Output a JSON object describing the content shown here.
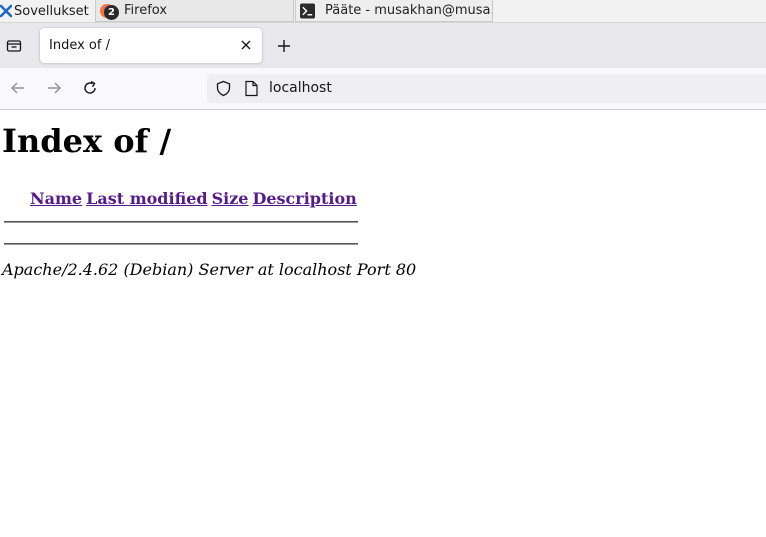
{
  "taskbar": {
    "apps_label": "Sovellukset",
    "tasks": [
      {
        "label": "Firefox",
        "badge": "2",
        "icon": "firefox-icon"
      },
      {
        "label": "Pääte - musakhan@musa...",
        "icon": "terminal-icon"
      }
    ]
  },
  "browser": {
    "tab": {
      "title": "Index of /"
    },
    "url": "localhost"
  },
  "page": {
    "heading": "Index of /",
    "columns": [
      "Name",
      "Last modified",
      "Size",
      "Description"
    ],
    "address": "Apache/2.4.62 (Debian) Server at localhost Port 80"
  },
  "colors": {
    "link_visited": "#551a8b",
    "tabstrip_bg": "#e8e8ed",
    "navbar_bg": "#f9f9fb"
  }
}
